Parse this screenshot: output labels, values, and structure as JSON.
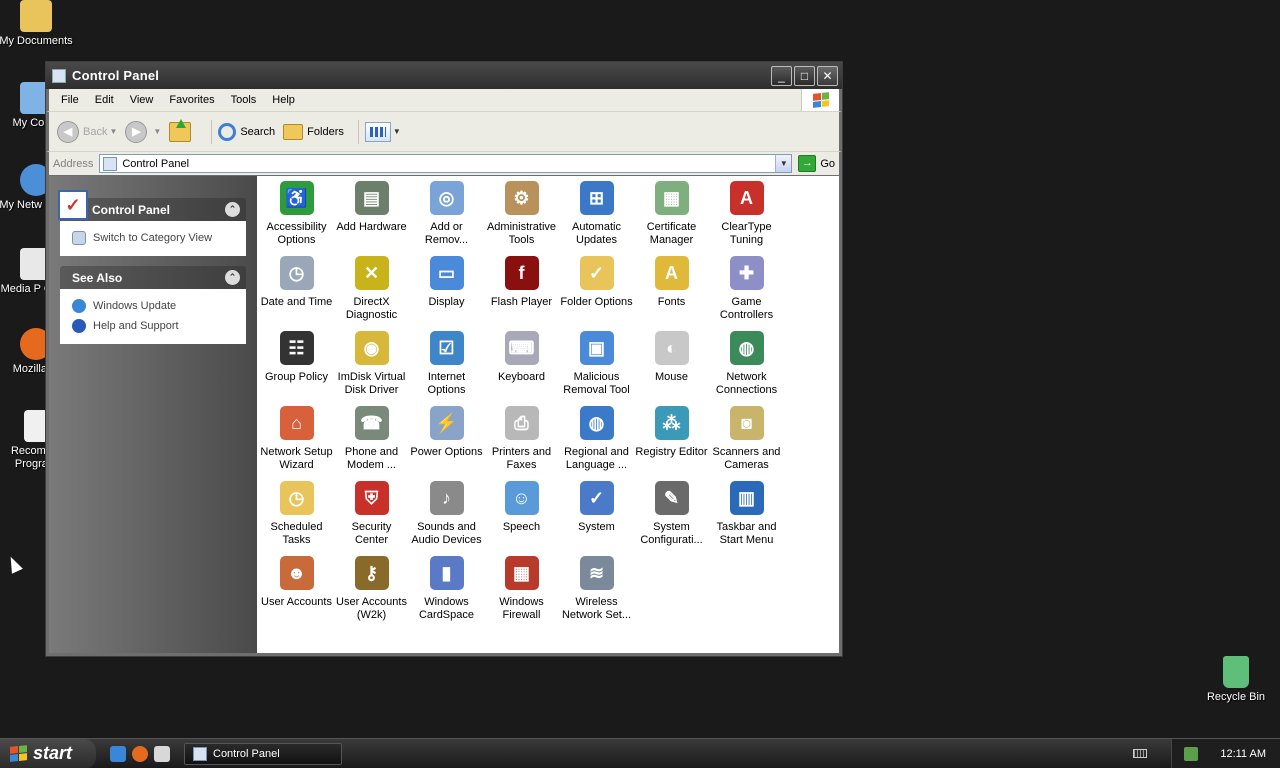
{
  "desktop": {
    "icons": [
      {
        "label": "My Documents",
        "color": "#e8c45a"
      },
      {
        "label": "My Comp",
        "color": "#7fb3e6"
      },
      {
        "label": "My Netw Place",
        "color": "#4c8ed8"
      },
      {
        "label": "Media P Class",
        "color": "#e8e8e8"
      },
      {
        "label": "Mozilla Fi",
        "color": "#e56a1e"
      },
      {
        "label": "Recomme Program",
        "color": "#f0f0f0"
      }
    ],
    "recycle_bin": {
      "label": "Recycle Bin",
      "color": "#5fbf7a"
    }
  },
  "window": {
    "title": "Control Panel",
    "buttons": {
      "minimize": "_",
      "maximize": "□",
      "close": "✕"
    }
  },
  "menubar": {
    "items": [
      "File",
      "Edit",
      "View",
      "Favorites",
      "Tools",
      "Help"
    ]
  },
  "toolbar": {
    "back_label": "Back",
    "search_label": "Search",
    "folders_label": "Folders"
  },
  "address": {
    "label": "Address",
    "value": "Control Panel",
    "go_label": "Go"
  },
  "taskpane": {
    "control_panel": {
      "title": "Control Panel",
      "links": [
        {
          "label": "Switch to Category View",
          "icon": "category-view-icon"
        }
      ]
    },
    "see_also": {
      "title": "See Also",
      "links": [
        {
          "label": "Windows Update",
          "icon": "windows-update-icon"
        },
        {
          "label": "Help and Support",
          "icon": "help-icon"
        }
      ]
    }
  },
  "control_panel_items": [
    {
      "label": "Accessibility Options",
      "icon": "accessibility-icon",
      "color": "#2e9b3e",
      "glyph": "♿"
    },
    {
      "label": "Add Hardware",
      "icon": "hardware-icon",
      "color": "#6b7f6a",
      "glyph": "▤"
    },
    {
      "label": "Add or Remov...",
      "icon": "add-remove-icon",
      "color": "#7aa3d8",
      "glyph": "◎"
    },
    {
      "label": "Administrative Tools",
      "icon": "admin-tools-icon",
      "color": "#b8925a",
      "glyph": "⚙"
    },
    {
      "label": "Automatic Updates",
      "icon": "updates-icon",
      "color": "#3b78c8",
      "glyph": "⊞"
    },
    {
      "label": "Certificate Manager",
      "icon": "certificate-icon",
      "color": "#7fae7f",
      "glyph": "▦"
    },
    {
      "label": "ClearType Tuning",
      "icon": "cleartype-icon",
      "color": "#c8302a",
      "glyph": "A"
    },
    {
      "label": "Date and Time",
      "icon": "clock-icon",
      "color": "#9aa7b8",
      "glyph": "◷"
    },
    {
      "label": "DirectX Diagnostic",
      "icon": "directx-icon",
      "color": "#c8b41a",
      "glyph": "✕"
    },
    {
      "label": "Display",
      "icon": "display-icon",
      "color": "#4a8ad8",
      "glyph": "▭"
    },
    {
      "label": "Flash Player",
      "icon": "flash-icon",
      "color": "#8a1010",
      "glyph": "f"
    },
    {
      "label": "Folder Options",
      "icon": "folder-options-icon",
      "color": "#e8c45a",
      "glyph": "✓"
    },
    {
      "label": "Fonts",
      "icon": "fonts-icon",
      "color": "#e0b83a",
      "glyph": "A"
    },
    {
      "label": "Game Controllers",
      "icon": "gamepad-icon",
      "color": "#8f8fc8",
      "glyph": "✚"
    },
    {
      "label": "Group Policy",
      "icon": "group-policy-icon",
      "color": "#333333",
      "glyph": "☷"
    },
    {
      "label": "ImDisk Virtual Disk Driver",
      "icon": "disk-icon",
      "color": "#d8b83a",
      "glyph": "◉"
    },
    {
      "label": "Internet Options",
      "icon": "internet-options-icon",
      "color": "#3f86c8",
      "glyph": "☑"
    },
    {
      "label": "Keyboard",
      "icon": "keyboard-icon",
      "color": "#a8a8b8",
      "glyph": "⌨"
    },
    {
      "label": "Malicious Removal Tool",
      "icon": "malware-tool-icon",
      "color": "#4a8ad8",
      "glyph": "▣"
    },
    {
      "label": "Mouse",
      "icon": "mouse-icon",
      "color": "#c8c8c8",
      "glyph": "◐"
    },
    {
      "label": "Network Connections",
      "icon": "network-icon",
      "color": "#3a8a5a",
      "glyph": "◍"
    },
    {
      "label": "Network Setup Wizard",
      "icon": "network-setup-icon",
      "color": "#d8603a",
      "glyph": "⌂"
    },
    {
      "label": "Phone and Modem ...",
      "icon": "phone-icon",
      "color": "#7a8a7a",
      "glyph": "☎"
    },
    {
      "label": "Power Options",
      "icon": "power-icon",
      "color": "#8aa3c8",
      "glyph": "⚡"
    },
    {
      "label": "Printers and Faxes",
      "icon": "printer-icon",
      "color": "#b8b8b8",
      "glyph": "⎙"
    },
    {
      "label": "Regional and Language ...",
      "icon": "globe-icon",
      "color": "#3a7ac8",
      "glyph": "◍"
    },
    {
      "label": "Registry Editor",
      "icon": "registry-icon",
      "color": "#3a9ab8",
      "glyph": "⁂"
    },
    {
      "label": "Scanners and Cameras",
      "icon": "scanner-icon",
      "color": "#c8b46a",
      "glyph": "◙"
    },
    {
      "label": "Scheduled Tasks",
      "icon": "scheduled-tasks-icon",
      "color": "#e8c45a",
      "glyph": "◷"
    },
    {
      "label": "Security Center",
      "icon": "shield-icon",
      "color": "#c8302a",
      "glyph": "⛨"
    },
    {
      "label": "Sounds and Audio Devices",
      "icon": "speaker-icon",
      "color": "#8a8a8a",
      "glyph": "♪"
    },
    {
      "label": "Speech",
      "icon": "speech-icon",
      "color": "#5a9ad8",
      "glyph": "☺"
    },
    {
      "label": "System",
      "icon": "system-icon",
      "color": "#4a7ac8",
      "glyph": "✓"
    },
    {
      "label": "System Configurati...",
      "icon": "system-config-icon",
      "color": "#6a6a6a",
      "glyph": "✎"
    },
    {
      "label": "Taskbar and Start Menu",
      "icon": "taskbar-icon",
      "color": "#2a6ab8",
      "glyph": "▥"
    },
    {
      "label": "User Accounts",
      "icon": "user-accounts-icon",
      "color": "#c86a3a",
      "glyph": "☻"
    },
    {
      "label": "User Accounts (W2k)",
      "icon": "user-accounts-w2k-icon",
      "color": "#8a6a2a",
      "glyph": "⚷"
    },
    {
      "label": "Windows CardSpace",
      "icon": "cardspace-icon",
      "color": "#5a7ac8",
      "glyph": "▮"
    },
    {
      "label": "Windows Firewall",
      "icon": "firewall-icon",
      "color": "#b83a2a",
      "glyph": "▦"
    },
    {
      "label": "Wireless Network Set...",
      "icon": "wireless-icon",
      "color": "#7a8a9a",
      "glyph": "≋"
    }
  ],
  "taskbar": {
    "start_label": "start",
    "task_label": "Control Panel",
    "clock": "12:11 AM"
  }
}
